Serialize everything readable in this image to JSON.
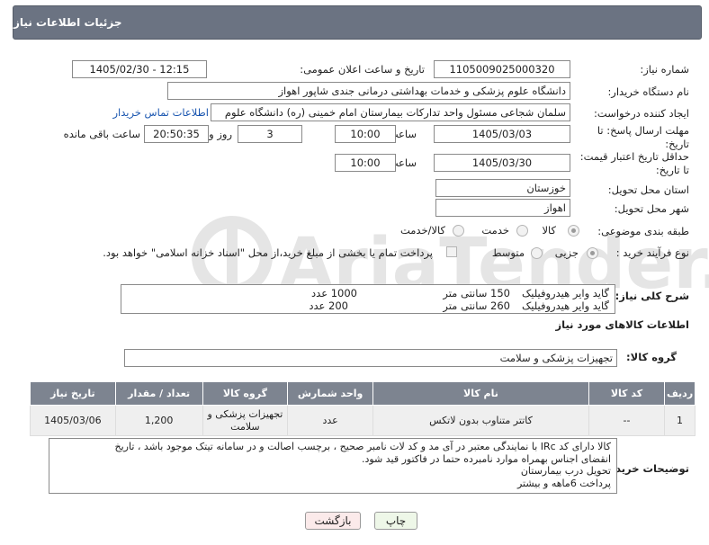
{
  "header": {
    "title": "جزئیات اطلاعات نیاز"
  },
  "form": {
    "need_number_label": "شماره نیاز:",
    "need_number": "1105009025000320",
    "announce_label": "تاریخ و ساعت اعلان عمومی:",
    "announce_value": "1405/02/30 - 12:15",
    "buyer_label": "نام دستگاه خریدار:",
    "buyer_value": "دانشگاه علوم پزشکی و خدمات بهداشتی درمانی جندی شاپور اهواز",
    "creator_label": "ایجاد کننده درخواست:",
    "creator_value": "سلمان شجاعی مسئول واحد تدارکات بیمارستان امام خمینی (ره) دانشگاه علوم",
    "contact_link": "اطلاعات تماس خریدار",
    "deadline_label_1": "مهلت ارسال پاسخ: تا",
    "deadline_label_2": "تاریخ:",
    "deadline_date": "1405/03/03",
    "time_label": "ساعت",
    "deadline_time": "10:00",
    "days_value": "3",
    "days_label": "روز و",
    "remaining_time": "20:50:35",
    "remaining_label": "ساعت باقی مانده",
    "validity_label_1": "حداقل تاریخ اعتبار قیمت:",
    "validity_label_2": "تا تاریخ:",
    "validity_date": "1405/03/30",
    "validity_time": "10:00",
    "province_label": "استان محل تحویل:",
    "province_value": "خوزستان",
    "city_label": "شهر محل تحویل:",
    "city_value": "اهواز",
    "category_label": "طبقه بندی موضوعی:",
    "category_options": [
      "کالا",
      "خدمت",
      "کالا/خدمت"
    ],
    "process_label": "نوع فرآیند خرید :",
    "process_options": [
      "جزیی",
      "متوسط"
    ],
    "payment_note": "پرداخت تمام یا بخشی از مبلغ خرید،از محل \"اسناد خزانه اسلامی\" خواهد بود."
  },
  "description": {
    "label": "شرح کلی نیاز:",
    "lines": [
      {
        "name": "گاید وایر هیدروفیلیک",
        "size": "150 سانتی متر",
        "qty": "1000 عدد"
      },
      {
        "name": "گاید وایر هیدروفیلیک",
        "size": "260 سانتی متر",
        "qty": "200 عدد"
      }
    ]
  },
  "goods": {
    "section_title": "اطلاعات کالاهای مورد نیاز",
    "group_label": "گروه کالا:",
    "group_value": "تجهیزات پزشکی و سلامت",
    "table_headers": [
      "ردیف",
      "کد کالا",
      "نام کالا",
      "واحد شمارش",
      "گروه کالا",
      "تعداد / مقدار",
      "تاریخ نیاز"
    ],
    "rows": [
      [
        "1",
        "--",
        "کاتتر متناوب بدون لاتکس",
        "عدد",
        "تجهیزات پزشکی و سلامت",
        "1,200",
        "1405/03/06"
      ]
    ]
  },
  "buyer_notes": {
    "label": "توضیحات خریدار:",
    "lines": [
      "کالا دارای کد IRc با نمایندگی معتبر در آی مد و کد لات نامبر صحیح ، برچسب اصالت و در سامانه تیتک موجود باشد ، تاریخ",
      "انقضای اجناس بهمراه موارد نامبرده حتما در فاکتور قید شود.",
      "تحویل درب بیمارستان",
      "پرداخت 6ماهه و بیشتر"
    ]
  },
  "buttons": {
    "print": "چاپ",
    "back": "بازگشت"
  },
  "watermark_text": "AriaTender.neT"
}
